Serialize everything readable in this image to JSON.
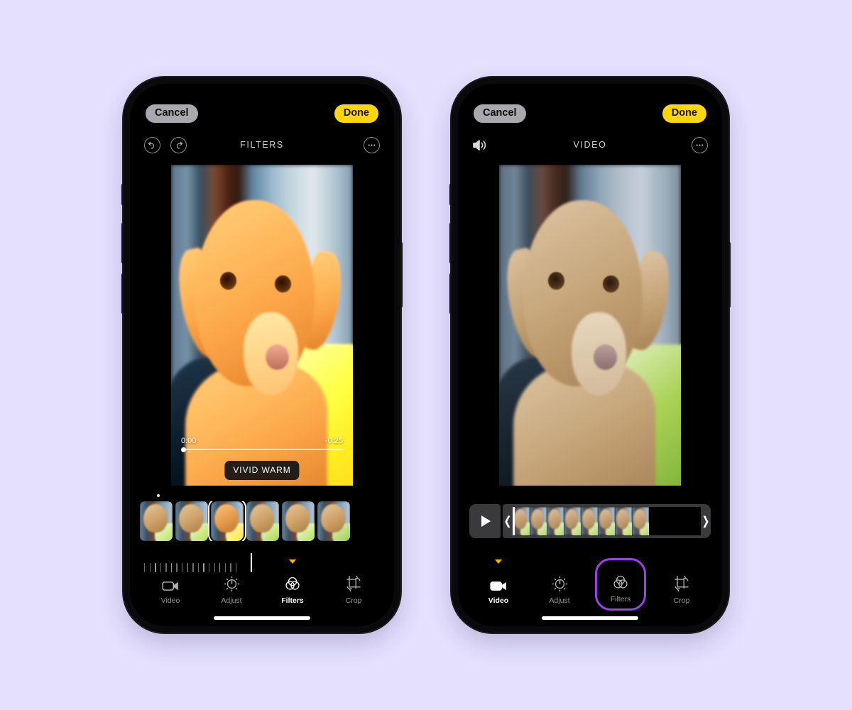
{
  "background_color": "#e5e0fe",
  "accent": {
    "done_yellow": "#ffd60a",
    "cancel_grey": "#a9a9ad",
    "active_caret": "#ffb300",
    "highlight_purple": "#9b3fe8"
  },
  "phones": [
    {
      "id": "filters-screen",
      "topbar": {
        "cancel_label": "Cancel",
        "done_label": "Done"
      },
      "toolrow": {
        "title": "FILTERS",
        "undo_icon": "undo-icon",
        "redo_icon": "redo-icon",
        "more_icon": "more-options-icon"
      },
      "preview": {
        "variant": "warm",
        "time_elapsed": "0:00",
        "time_remaining": "-0:25",
        "filter_name": "VIVID WARM"
      },
      "filter_strip": {
        "page_dot": "•",
        "selected_index": 2,
        "thumbs": [
          "thumb-1",
          "thumb-2",
          "thumb-3",
          "thumb-4",
          "thumb-5",
          "thumb-6"
        ]
      },
      "intensity_ruler": {
        "ticks": 18,
        "cursor_position_pct": 82
      },
      "tabs": [
        {
          "label": "Video",
          "icon": "video-camera-icon",
          "active": false,
          "highlight": false
        },
        {
          "label": "Adjust",
          "icon": "adjust-dial-icon",
          "active": false,
          "highlight": false
        },
        {
          "label": "Filters",
          "icon": "filters-circles-icon",
          "active": true,
          "highlight": false
        },
        {
          "label": "Crop",
          "icon": "crop-rotate-icon",
          "active": false,
          "highlight": false
        }
      ]
    },
    {
      "id": "video-screen",
      "topbar": {
        "cancel_label": "Cancel",
        "done_label": "Done"
      },
      "toolrow": {
        "title": "VIDEO",
        "speaker_icon": "speaker-volume-icon",
        "more_icon": "more-options-icon"
      },
      "preview": {
        "variant": "cool"
      },
      "trimmer": {
        "play_icon": "play-icon",
        "handle_left": "❬",
        "handle_right": "❭",
        "frame_count": 8
      },
      "tabs": [
        {
          "label": "Video",
          "icon": "video-camera-icon",
          "active": true,
          "highlight": false
        },
        {
          "label": "Adjust",
          "icon": "adjust-dial-icon",
          "active": false,
          "highlight": false
        },
        {
          "label": "Filters",
          "icon": "filters-circles-icon",
          "active": false,
          "highlight": true
        },
        {
          "label": "Crop",
          "icon": "crop-rotate-icon",
          "active": false,
          "highlight": false
        }
      ]
    }
  ]
}
